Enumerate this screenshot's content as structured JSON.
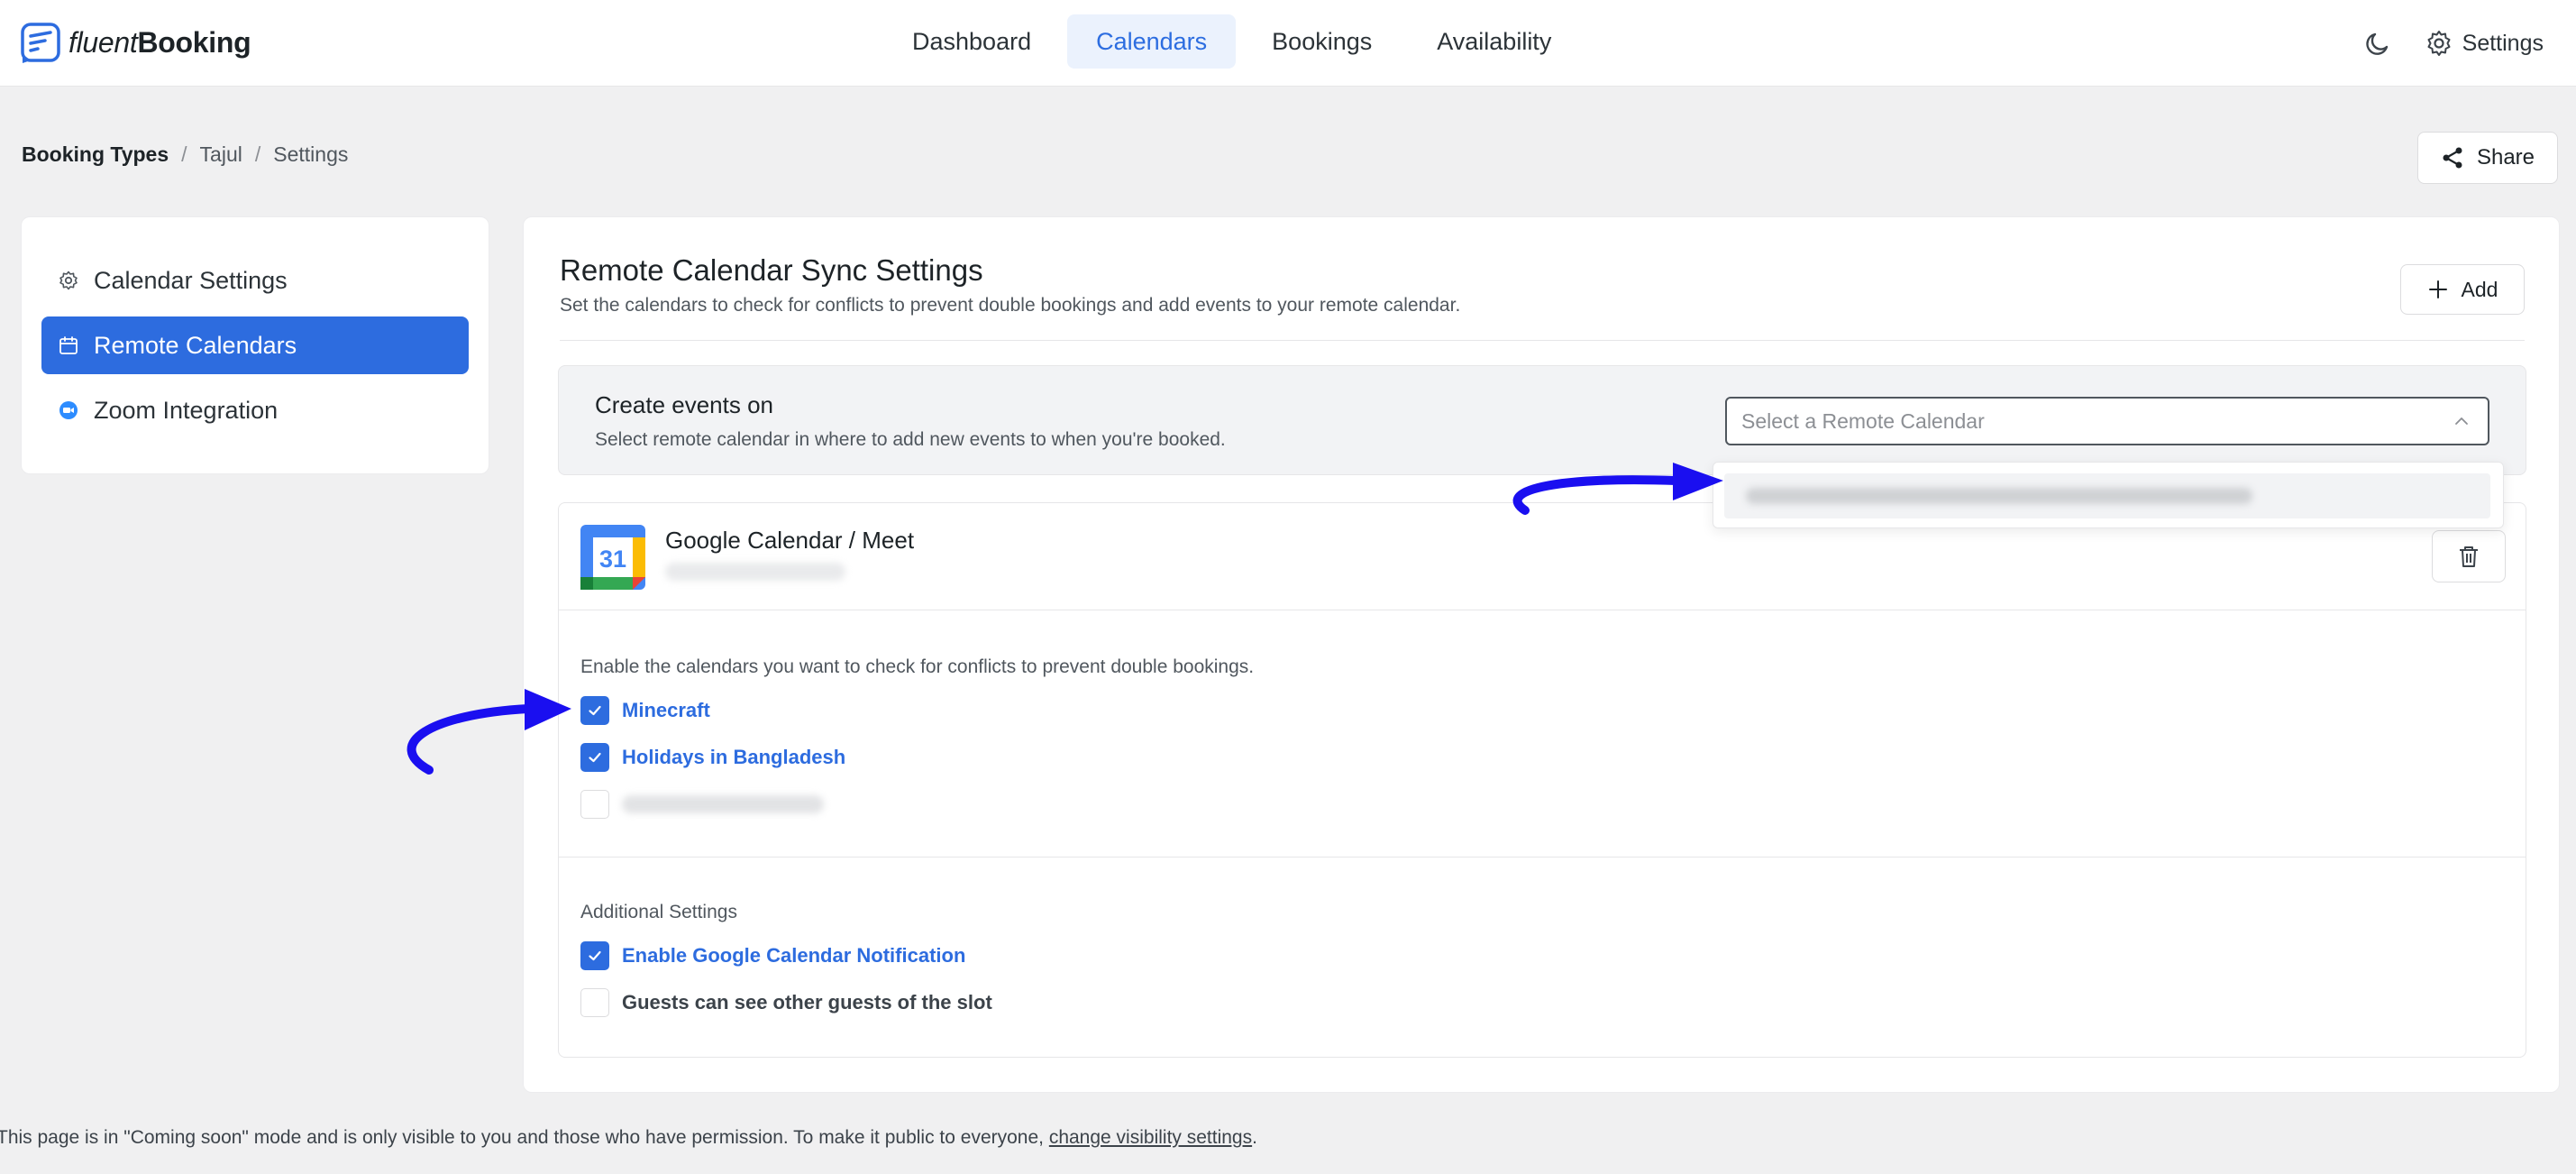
{
  "brand": {
    "name_light": "fluent",
    "name_bold": "Booking"
  },
  "nav": {
    "items": [
      "Dashboard",
      "Calendars",
      "Bookings",
      "Availability"
    ],
    "active": "Calendars"
  },
  "header_right": {
    "settings_label": "Settings"
  },
  "breadcrumb": {
    "items": [
      "Booking Types",
      "Tajul",
      "Settings"
    ],
    "separator": "/"
  },
  "share_label": "Share",
  "sidebar": {
    "items": [
      {
        "label": "Calendar Settings",
        "icon": "gear-icon",
        "active": false
      },
      {
        "label": "Remote Calendars",
        "icon": "calendar-icon",
        "active": true
      },
      {
        "label": "Zoom Integration",
        "icon": "zoom-icon",
        "active": false
      }
    ]
  },
  "main": {
    "title": "Remote Calendar Sync Settings",
    "description": "Set the calendars to check for conflicts to prevent double bookings and add events to your remote calendar.",
    "add_label": "Add",
    "create_events": {
      "title": "Create events on",
      "description": "Select remote calendar in where to add new events to when you're booked.",
      "select_placeholder": "Select a Remote Calendar"
    },
    "google": {
      "name": "Google Calendar / Meet",
      "calendar_icon_day": "31",
      "conflict_description": "Enable the calendars you want to check for conflicts to prevent double bookings.",
      "calendars": [
        {
          "label": "Minecraft",
          "checked": true
        },
        {
          "label": "Holidays in Bangladesh",
          "checked": true
        }
      ],
      "additional_title": "Additional Settings",
      "additional": [
        {
          "label": "Enable Google Calendar Notification",
          "checked": true
        },
        {
          "label": "Guests can see other guests of the slot",
          "checked": false
        }
      ]
    }
  },
  "footer": {
    "text": "This page is in \"Coming soon\" mode and is only visible to you and those who have permission. To make it public to everyone, ",
    "link": "change visibility settings",
    "trailing": "."
  },
  "colors": {
    "accent": "#2d6cdf",
    "annotation_arrow": "#1a0ff0"
  }
}
